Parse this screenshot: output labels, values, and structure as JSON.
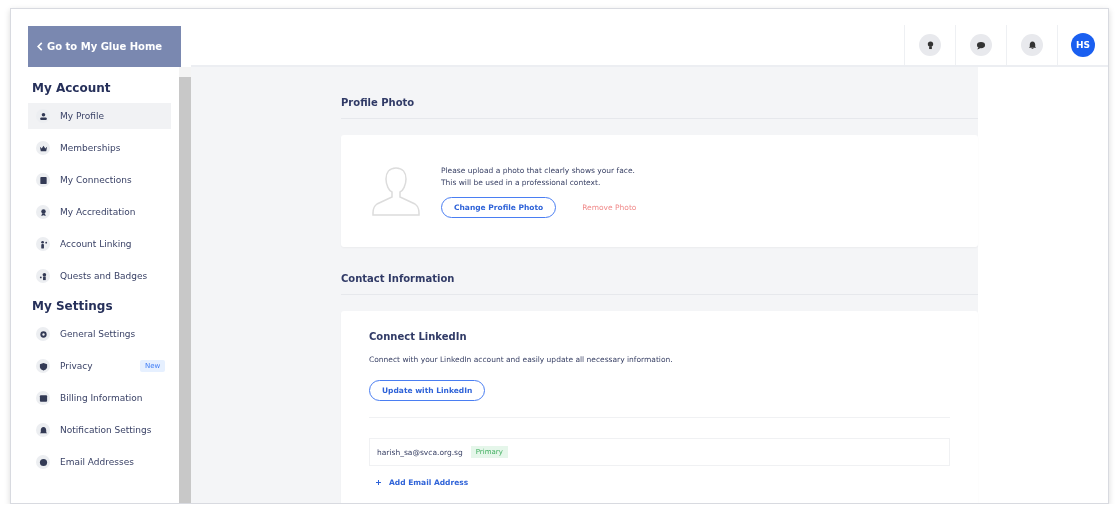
{
  "header": {
    "back_button": "Go to My Glue Home",
    "avatar": "HS"
  },
  "sidebar": {
    "sections": [
      {
        "title": "My Account",
        "items": [
          {
            "label": "My Profile",
            "selected": true
          },
          {
            "label": "Memberships",
            "selected": false
          },
          {
            "label": "My Connections",
            "selected": false
          },
          {
            "label": "My Accreditation",
            "selected": false
          },
          {
            "label": "Account Linking",
            "selected": false
          },
          {
            "label": "Quests and Badges",
            "selected": false
          }
        ]
      },
      {
        "title": "My Settings",
        "items": [
          {
            "label": "General Settings",
            "selected": false
          },
          {
            "label": "Privacy",
            "selected": false,
            "badge": "New"
          },
          {
            "label": "Billing Information",
            "selected": false
          },
          {
            "label": "Notification Settings",
            "selected": false
          },
          {
            "label": "Email Addresses",
            "selected": false
          }
        ]
      }
    ]
  },
  "profile_photo": {
    "title": "Profile Photo",
    "lines": [
      "Please upload a photo that clearly shows your face.",
      "This will be used in a professional context."
    ],
    "change_button": "Change Profile Photo",
    "remove_link": "Remove Photo"
  },
  "contact": {
    "title": "Contact Information",
    "linkedin_title": "Connect LinkedIn",
    "linkedin_text": "Connect with your LinkedIn account and easily update all necessary information.",
    "linkedin_button": "Update with LinkedIn",
    "emails": [
      {
        "address": "harish_sa@svca.org.sg",
        "tag": "Primary"
      }
    ],
    "add_email": "Add Email Address"
  }
}
